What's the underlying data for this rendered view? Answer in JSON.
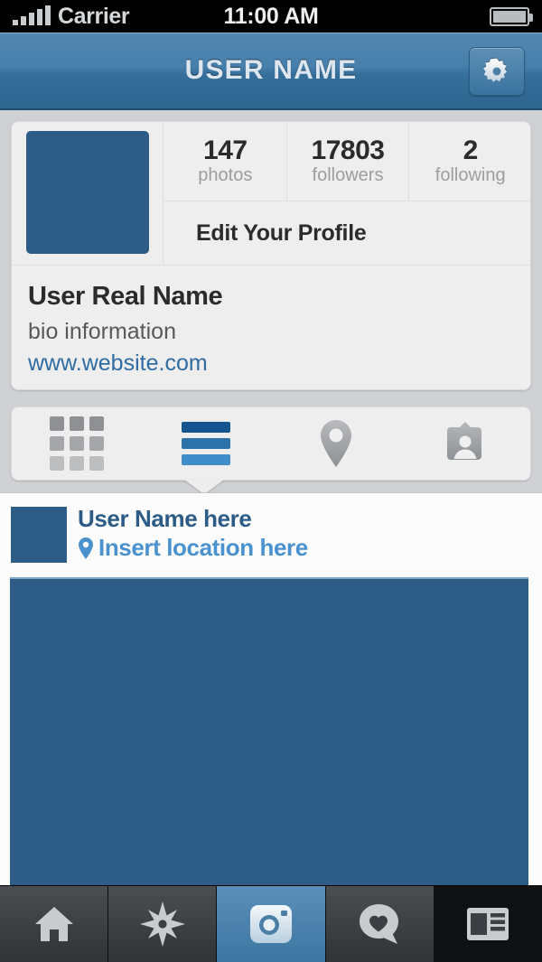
{
  "status_bar": {
    "carrier": "Carrier",
    "time": "11:00 AM",
    "signal_bars": 5,
    "battery_icon": "battery-full-icon"
  },
  "nav_bar": {
    "title": "USER NAME",
    "settings_icon": "gear-icon",
    "gradient_top": "#5288b1",
    "gradient_bottom": "#2e6590"
  },
  "profile": {
    "avatar_icon": "profile-avatar",
    "avatar_color": "#2d5c87",
    "stats": [
      {
        "value": "147",
        "label": "photos"
      },
      {
        "value": "17803",
        "label": "followers"
      },
      {
        "value": "2",
        "label": "following"
      }
    ],
    "edit_profile_label": "Edit Your Profile",
    "real_name": "User Real Name",
    "bio": "bio information",
    "website": "www.website.com",
    "website_color": "#2f6ca3"
  },
  "view_tabs": {
    "active_index": 1,
    "items": [
      {
        "name": "grid-view-tab",
        "icon": "grid-icon"
      },
      {
        "name": "list-view-tab",
        "icon": "list-icon"
      },
      {
        "name": "map-view-tab",
        "icon": "location-pin-icon"
      },
      {
        "name": "tagged-view-tab",
        "icon": "photos-of-you-icon"
      }
    ]
  },
  "feed": {
    "post": {
      "avatar_icon": "post-avatar",
      "user_name": "User Name here",
      "location": "Insert location here",
      "location_icon": "location-pin-icon",
      "photo_color": "#2d5c87",
      "user_name_color": "#2c5c85",
      "location_color": "#4a92ce"
    }
  },
  "bottom_tab_bar": {
    "active_index": 2,
    "items": [
      {
        "name": "home-tab",
        "icon": "home-icon"
      },
      {
        "name": "explore-tab",
        "icon": "compass-star-icon"
      },
      {
        "name": "camera-tab",
        "icon": "camera-icon"
      },
      {
        "name": "activity-tab",
        "icon": "heart-bubble-icon"
      },
      {
        "name": "profile-tab",
        "icon": "profile-card-icon"
      }
    ]
  }
}
